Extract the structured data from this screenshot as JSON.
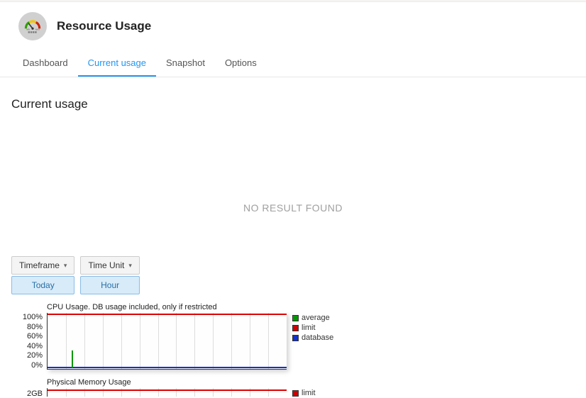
{
  "header": {
    "title": "Resource Usage"
  },
  "tabs": [
    {
      "id": "dashboard",
      "label": "Dashboard"
    },
    {
      "id": "current",
      "label": "Current usage"
    },
    {
      "id": "snapshot",
      "label": "Snapshot"
    },
    {
      "id": "options",
      "label": "Options"
    }
  ],
  "section": {
    "title": "Current usage",
    "no_result": "NO RESULT FOUND"
  },
  "controls": {
    "timeframe": {
      "label": "Timeframe",
      "selected": "Today"
    },
    "timeunit": {
      "label": "Time Unit",
      "selected": "Hour"
    }
  },
  "charts": {
    "cpu": {
      "title": "CPU Usage. DB usage included, only if restricted",
      "y_ticks": [
        "100%",
        "80%",
        "60%",
        "40%",
        "20%",
        "0%"
      ],
      "legend": [
        {
          "name": "average",
          "color": "#009800"
        },
        {
          "name": "limit",
          "color": "#d00000"
        },
        {
          "name": "database",
          "color": "#1030d0"
        }
      ]
    },
    "mem": {
      "title": "Physical Memory Usage",
      "y_ticks": [
        "2GB"
      ],
      "legend": [
        {
          "name": "limit",
          "color": "#d00000"
        }
      ]
    }
  },
  "chart_data": [
    {
      "type": "line",
      "title": "CPU Usage. DB usage included, only if restricted",
      "ylabel": "%",
      "ylim": [
        0,
        100
      ],
      "x": [
        0,
        1,
        2,
        3,
        4,
        5,
        6,
        7,
        8,
        9,
        10,
        11,
        12,
        13,
        14,
        15,
        16,
        17,
        18,
        19,
        20,
        21,
        22,
        23
      ],
      "series": [
        {
          "name": "average",
          "values": [
            0,
            0,
            30,
            0,
            0,
            0,
            0,
            0,
            0,
            0,
            0,
            0,
            0,
            0,
            0,
            0,
            0,
            0,
            0,
            0,
            0,
            0,
            0,
            0
          ]
        },
        {
          "name": "limit",
          "values": [
            100,
            100,
            100,
            100,
            100,
            100,
            100,
            100,
            100,
            100,
            100,
            100,
            100,
            100,
            100,
            100,
            100,
            100,
            100,
            100,
            100,
            100,
            100,
            100
          ]
        },
        {
          "name": "database",
          "values": [
            0,
            0,
            0,
            0,
            0,
            0,
            0,
            0,
            0,
            0,
            0,
            0,
            0,
            0,
            0,
            0,
            0,
            0,
            0,
            0,
            0,
            0,
            0,
            0
          ]
        }
      ]
    },
    {
      "type": "line",
      "title": "Physical Memory Usage",
      "ylabel": "GB",
      "ylim": [
        0,
        2
      ],
      "x": [
        0,
        1,
        2,
        3,
        4,
        5,
        6,
        7,
        8,
        9,
        10,
        11,
        12,
        13,
        14,
        15,
        16,
        17,
        18,
        19,
        20,
        21,
        22,
        23
      ],
      "series": [
        {
          "name": "limit",
          "values": [
            2,
            2,
            2,
            2,
            2,
            2,
            2,
            2,
            2,
            2,
            2,
            2,
            2,
            2,
            2,
            2,
            2,
            2,
            2,
            2,
            2,
            2,
            2,
            2
          ]
        }
      ]
    }
  ]
}
